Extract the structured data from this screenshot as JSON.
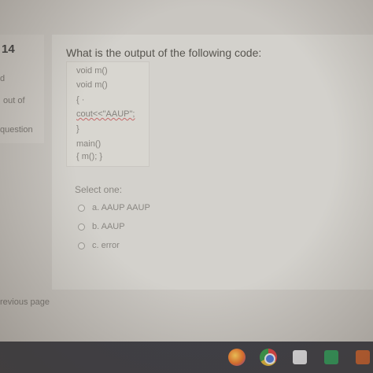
{
  "sidebar": {
    "question_number": "14",
    "status_fragment": "d",
    "marks_fragment": "out of",
    "flag_fragment": "question"
  },
  "question": {
    "prompt": "What is the output of the following code:",
    "code_lines": [
      "void m()",
      "void m()",
      "{ ·",
      "cout<<\"AAUP\";",
      "}",
      "main()",
      "{ m(); }"
    ]
  },
  "answers": {
    "select_label": "Select one:",
    "options": [
      "a. AAUP AAUP",
      "b. AAUP",
      "c. error"
    ]
  },
  "navigation": {
    "previous_page": "revious page"
  },
  "taskbar": {
    "icons": [
      "firefox-icon",
      "chrome-icon",
      "app-icon",
      "app-icon",
      "app-icon"
    ]
  }
}
